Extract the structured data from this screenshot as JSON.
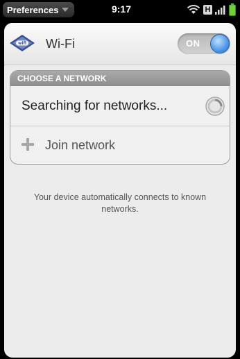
{
  "status_bar": {
    "app_menu_label": "Preferences",
    "time": "9:17",
    "network_type": "H"
  },
  "wifi": {
    "title": "Wi-Fi",
    "toggle_label": "ON"
  },
  "network_group": {
    "header": "CHOOSE A NETWORK",
    "searching_text": "Searching for networks...",
    "join_label": "Join network"
  },
  "info_text": "Your device automatically connects to known networks.",
  "colors": {
    "toggle_knob": "#4d97e8",
    "battery": "#6fd23a"
  }
}
